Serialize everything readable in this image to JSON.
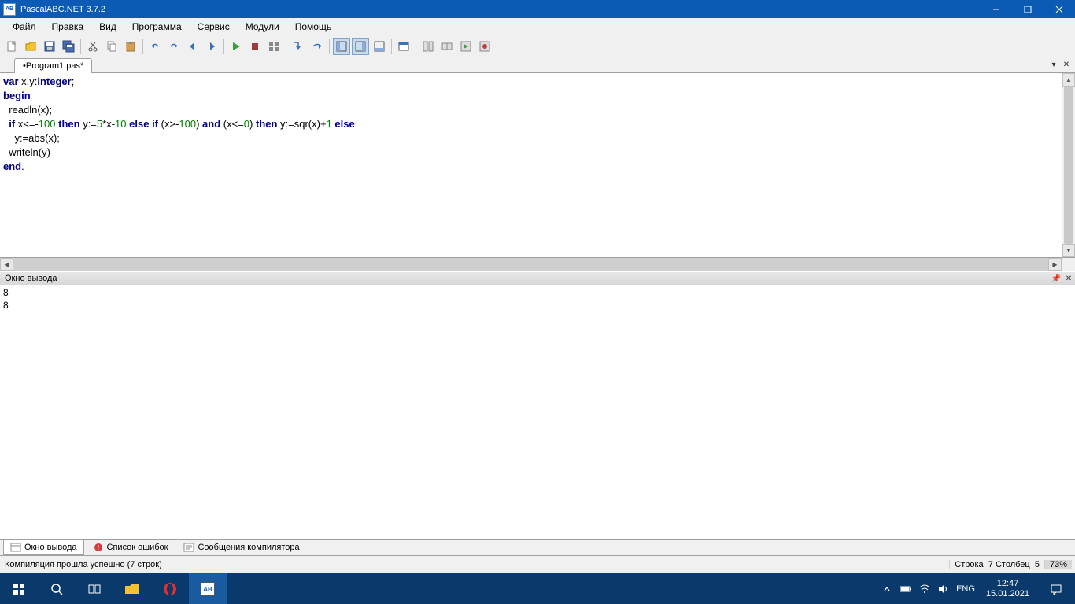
{
  "window": {
    "title": "PascalABC.NET 3.7.2"
  },
  "menu": [
    "Файл",
    "Правка",
    "Вид",
    "Программа",
    "Сервис",
    "Модули",
    "Помощь"
  ],
  "tab": {
    "label": "•Program1.pas*"
  },
  "code": {
    "l1a": "var",
    "l1b": " x,y:",
    "l1c": "integer",
    "l1d": ";",
    "l2": "begin",
    "l3": "  readln(x);",
    "l4a": "  if",
    "l4b": " x<=-",
    "l4c": "100",
    "l4d": " ",
    "l4e": "then",
    "l4f": " y:=",
    "l4g": "5",
    "l4h": "*x-",
    "l4i": "10",
    "l4j": " ",
    "l4k": "else",
    "l4l": " ",
    "l4m": "if",
    "l4n": " (x>-",
    "l4o": "100",
    "l4p": ") ",
    "l4q": "and",
    "l4r": " (x<=",
    "l4s": "0",
    "l4t": ") ",
    "l4u": "then",
    "l4v": " y:=sqr(x)+",
    "l4w": "1",
    "l4x": " ",
    "l4y": "else",
    "l5": "    y:=abs(x);",
    "l6": "  writeln(y)",
    "l7a": "end",
    "l7b": "."
  },
  "output": {
    "title": "Окно вывода",
    "lines": [
      "8",
      "8"
    ]
  },
  "bottom_tabs": [
    "Окно вывода",
    "Список ошибок",
    "Сообщения компилятора"
  ],
  "status": {
    "msg": "Компиляция прошла успешно (7 строк)",
    "line_lbl": "Строка",
    "line": "7",
    "col_lbl": "Столбец",
    "col": "5",
    "zoom": "73%"
  },
  "taskbar": {
    "lang": "ENG",
    "time": "12:47",
    "date": "15.01.2021"
  }
}
